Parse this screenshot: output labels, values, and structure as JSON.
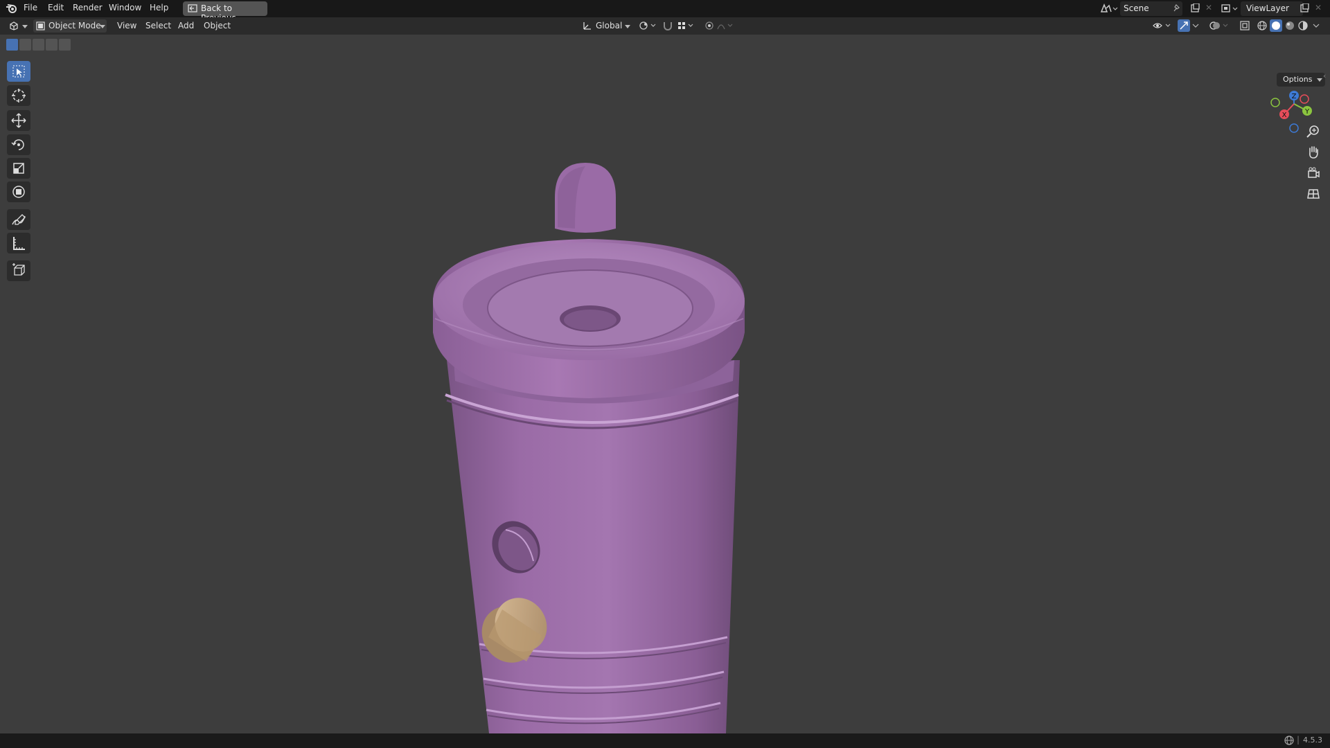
{
  "menubar": {
    "items": [
      "File",
      "Edit",
      "Render",
      "Window",
      "Help"
    ],
    "back_button": "Back to Previous",
    "scene": "Scene",
    "view_layer": "ViewLayer"
  },
  "header": {
    "mode": "Object Mode",
    "menus": [
      "View",
      "Select",
      "Add",
      "Object"
    ],
    "orientation": "Global"
  },
  "viewport": {
    "options_label": "Options",
    "gizmo_axes": {
      "x": "X",
      "y": "Y",
      "z": "Z"
    }
  },
  "tools": [
    "select-box",
    "cursor",
    "move",
    "rotate",
    "scale",
    "transform",
    "annotate",
    "measure",
    "add-cube"
  ],
  "statusbar": {
    "version": "4.5.3"
  },
  "colors": {
    "accent": "#4772b3",
    "model": "#9a6ba6",
    "cap": "#c9a983",
    "background": "#3d3d3d"
  }
}
